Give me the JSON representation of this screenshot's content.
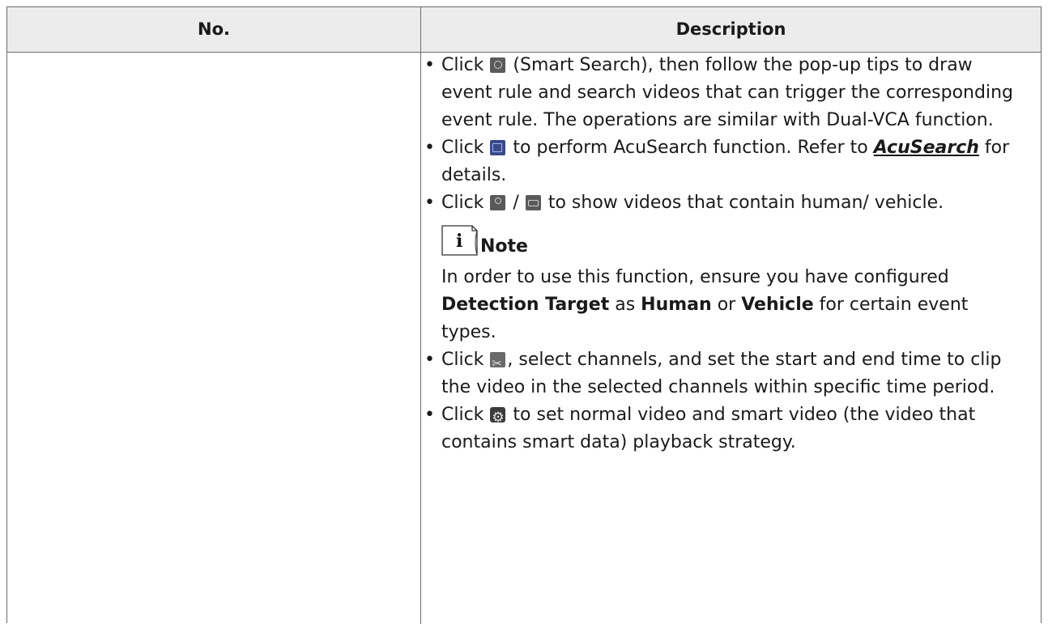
{
  "table": {
    "headers": {
      "no": "No.",
      "description": "Description"
    }
  },
  "items": {
    "smart_search": {
      "bullet": "•",
      "pre": "Click",
      "icon": "smart-search-icon",
      "post": "(Smart Search), then follow the pop-up tips to draw event rule and search videos that can trigger the corresponding event rule. The operations are similar with Dual-VCA function."
    },
    "acusearch": {
      "bullet": "•",
      "pre": "Click",
      "icon": "acusearch-icon",
      "post": "to perform AcuSearch function. Refer to",
      "link": "AcuSearch",
      "tail": "for details."
    },
    "human_vehicle": {
      "bullet": "•",
      "pre": "Click",
      "icon1": "human-icon",
      "separator": "/",
      "icon2": "vehicle-icon",
      "post": "to show videos that contain human/ vehicle."
    },
    "note": {
      "title": "Note",
      "text_1": "In order to use this function, ensure you have configured",
      "bold_1": "Detection Target",
      "text_2": "as",
      "bold_2": "Human",
      "text_3": "or",
      "bold_3": "Vehicle",
      "text_4": "for certain event types."
    },
    "clip": {
      "bullet": "•",
      "pre": "Click",
      "icon": "clip-icon",
      "post": ", select channels, and set the start and end time to clip the video in the selected channels within specific time period."
    },
    "strategy": {
      "bullet": "•",
      "pre": "Click",
      "icon": "settings-gear-icon",
      "post": "to set normal video and smart video (the video that contains smart data) playback strategy."
    }
  }
}
